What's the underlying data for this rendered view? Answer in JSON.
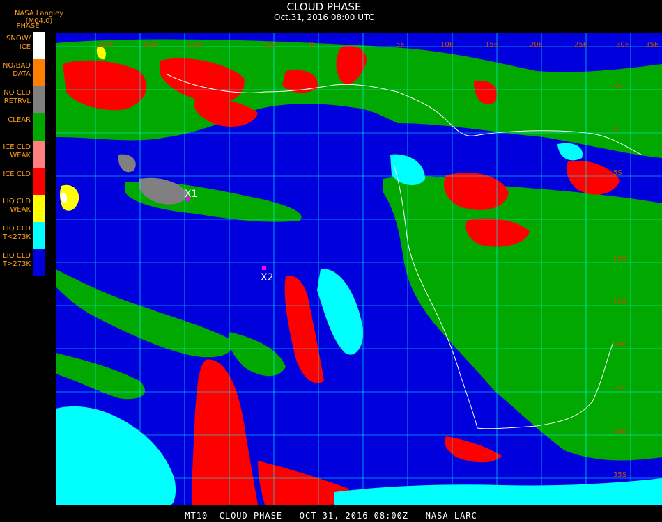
{
  "header": {
    "provider": "NASA Langley (M04.0)",
    "title": "CLOUD PHASE",
    "date": "Oct.31, 2016 08:00 UTC"
  },
  "legend": {
    "caption": "PHASE",
    "items": [
      {
        "label": "SNOW/\nICE",
        "color": "#ffffff"
      },
      {
        "label": "NO/BAD\nDATA",
        "color": "#ff7f00"
      },
      {
        "label": "NO CLD\nRETRVL",
        "color": "#808080"
      },
      {
        "label": "CLEAR",
        "color": "#00a800"
      },
      {
        "label": "ICE CLD\nWEAK",
        "color": "#ff8080"
      },
      {
        "label": "ICE CLD",
        "color": "#ff0000"
      },
      {
        "label": "LIQ CLD\nWEAK",
        "color": "#ffff00"
      },
      {
        "label": "LIQ CLD\nT<273K",
        "color": "#00ffff"
      },
      {
        "label": "LIQ CLD\nT>273K",
        "color": "#0000dd"
      }
    ]
  },
  "map": {
    "lon_labels": [
      "20W",
      "15W",
      "10W",
      "5W",
      "0",
      "5E",
      "10E",
      "15E",
      "20E",
      "25E",
      "30E",
      "35E"
    ],
    "lat_labels": [
      "5N",
      "0",
      "5S",
      "10S",
      "15S",
      "20S",
      "25S",
      "30S",
      "35S"
    ],
    "markers": [
      {
        "label": "X1",
        "color": "#ff00ff"
      },
      {
        "label": "X2",
        "color": "#ff00ff"
      }
    ],
    "colors": {
      "grid": "#00ffff",
      "coastline": "#ffffff",
      "lon_label": "#c05000",
      "lat_label": "#c05000"
    }
  },
  "footer": {
    "text": "MT10  CLOUD PHASE   OCT 31, 2016 08:00Z   NASA LARC"
  }
}
